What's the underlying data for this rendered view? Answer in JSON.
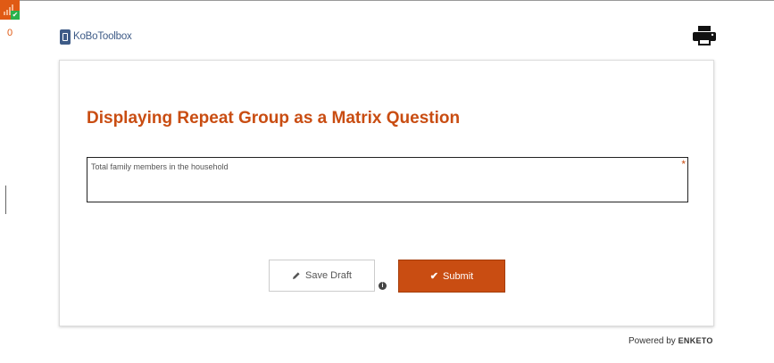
{
  "status": {
    "queue_count": "0",
    "badge_icon": "offline-status-icon"
  },
  "header": {
    "logo_bold": "KoBo",
    "logo_light": "Toolbox",
    "print_icon": "print-icon"
  },
  "form": {
    "title": "Displaying Repeat Group as a Matrix Question",
    "question": {
      "label": "Total family members in the household",
      "required_marker": "*"
    }
  },
  "actions": {
    "save_draft_label": "Save Draft",
    "info_icon": "i",
    "submit_label": "Submit"
  },
  "footer": {
    "powered_text": "Powered by",
    "brand": "ENKETO"
  },
  "colors": {
    "accent": "#c94d12",
    "logo": "#3e5b87",
    "badge_ok": "#2bb24c"
  }
}
